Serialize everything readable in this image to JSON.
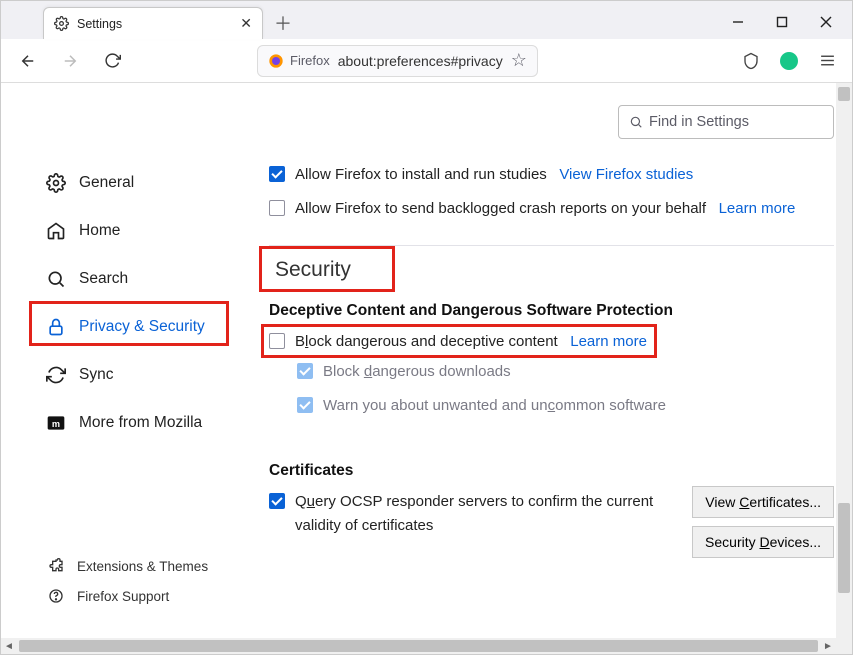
{
  "tab": {
    "title": "Settings"
  },
  "url": {
    "identity": "Firefox",
    "value": "about:preferences#privacy"
  },
  "find": {
    "placeholder": "Find in Settings"
  },
  "sidebar": {
    "items": [
      {
        "label": "General"
      },
      {
        "label": "Home"
      },
      {
        "label": "Search"
      },
      {
        "label": "Privacy & Security"
      },
      {
        "label": "Sync"
      },
      {
        "label": "More from Mozilla"
      }
    ],
    "footer": [
      {
        "label": "Extensions & Themes"
      },
      {
        "label": "Firefox Support"
      }
    ]
  },
  "main": {
    "studies": {
      "label_pre": "Allow Firefox to install and run studies",
      "link": "View Firefox studies"
    },
    "crash": {
      "label_pre": "Allow Firefox to send backlogged crash reports on your behalf",
      "link": "Learn more"
    },
    "security_heading": "Security",
    "deceptive": {
      "heading": "Deceptive Content and Dangerous Software Protection",
      "block_pre": "B",
      "block_und": "l",
      "block_post": "ock dangerous and deceptive content",
      "learn": "Learn more",
      "dl_pre": "Block ",
      "dl_und": "d",
      "dl_post": "angerous downloads",
      "warn_pre": "Warn you about unwanted and un",
      "warn_und": "c",
      "warn_post": "ommon software"
    },
    "certificates": {
      "heading": "Certificates",
      "ocsp_pre": "Q",
      "ocsp_und": "u",
      "ocsp_post": "ery OCSP responder servers to confirm the current validity of certificates",
      "view_pre": "View ",
      "view_und": "C",
      "view_post": "ertificates...",
      "dev_pre": "Security ",
      "dev_und": "D",
      "dev_post": "evices..."
    }
  }
}
